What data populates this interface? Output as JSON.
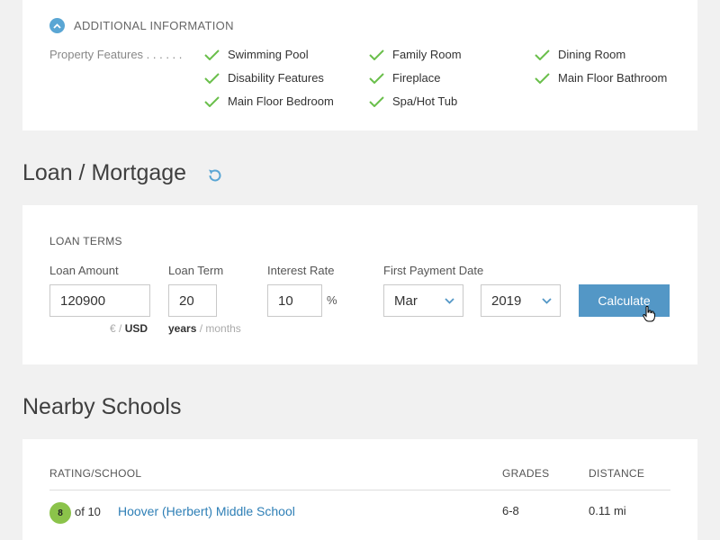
{
  "additional_info": {
    "title": "ADDITIONAL INFORMATION",
    "features_label": "Property Features . . . . . .",
    "features": [
      "Swimming Pool",
      "Family Room",
      "Dining Room",
      "Disability Features",
      "Fireplace",
      "Main Floor Bathroom",
      "Main Floor Bedroom",
      "Spa/Hot Tub"
    ]
  },
  "loan": {
    "title": "Loan / Mortgage",
    "terms_label": "LOAN TERMS",
    "amount_label": "Loan Amount",
    "amount_value": "120900",
    "currency_sub": "€ / USD",
    "currency_euro": "€ /",
    "currency_selected": "USD",
    "term_label": "Loan Term",
    "term_value": "20",
    "term_years": "years",
    "term_months": "/ months",
    "rate_label": "Interest Rate",
    "rate_value": "10",
    "rate_unit": "%",
    "first_payment_label": "First Payment Date",
    "month_value": "Mar",
    "year_value": "2019",
    "calculate_label": "Calculate"
  },
  "schools": {
    "title": "Nearby Schools",
    "headers": {
      "rating_school": "RATING/SCHOOL",
      "grades": "GRADES",
      "distance": "DISTANCE"
    },
    "rows": [
      {
        "rating": "8",
        "of": "of 10",
        "name": "Hoover (Herbert) Middle School",
        "grades": "6-8",
        "distance": "0.11 mi"
      }
    ]
  },
  "colors": {
    "accent": "#5397c6",
    "check": "#6abf4b",
    "rating_badge": "#8bc34a",
    "link": "#2e7fb6"
  },
  "icons": [
    "chevron-up-icon",
    "check-icon",
    "refresh-icon",
    "chevron-down-icon",
    "hand-cursor-icon"
  ]
}
